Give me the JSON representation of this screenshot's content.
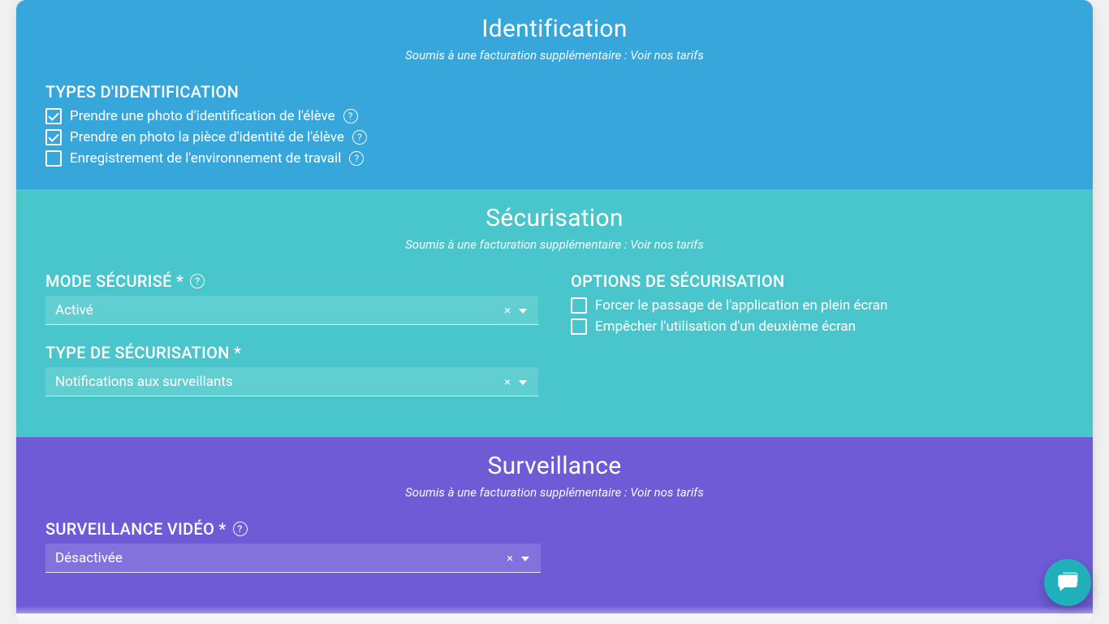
{
  "identification": {
    "title": "Identification",
    "subtitle": "Soumis à une facturation supplémentaire : Voir nos tarifs",
    "types_title": "TYPES D'IDENTIFICATION",
    "options": [
      {
        "label": "Prendre une photo d'identification de l'élève",
        "checked": true,
        "help": true
      },
      {
        "label": "Prendre en photo la pièce d'identité de l'élève",
        "checked": true,
        "help": true
      },
      {
        "label": "Enregistrement de l'environnement de travail",
        "checked": false,
        "help": true
      }
    ]
  },
  "securisation": {
    "title": "Sécurisation",
    "subtitle": "Soumis à une facturation supplémentaire : Voir nos tarifs",
    "mode_label": "MODE SÉCURISÉ *",
    "mode_value": "Activé",
    "type_label": "TYPE DE SÉCURISATION *",
    "type_value": "Notifications aux surveillants",
    "options_title": "OPTIONS DE SÉCURISATION",
    "options": [
      {
        "label": "Forcer le passage de l'application en plein écran",
        "checked": false
      },
      {
        "label": "Empêcher l'utilisation d'un deuxième écran",
        "checked": false
      }
    ]
  },
  "surveillance": {
    "title": "Surveillance",
    "subtitle": "Soumis à une facturation supplémentaire : Voir nos tarifs",
    "video_label": "SURVEILLANCE VIDÉO *",
    "video_value": "Désactivée"
  },
  "icons": {
    "clear": "×",
    "help_glyph": "?"
  }
}
